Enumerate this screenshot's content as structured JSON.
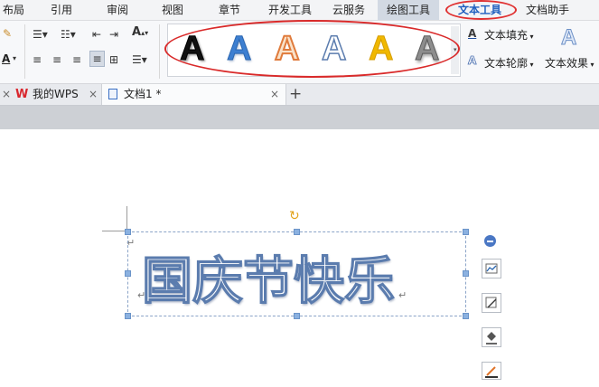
{
  "menu": {
    "tabs": [
      "布局",
      "引用",
      "审阅",
      "视图",
      "章节",
      "开发工具",
      "云服务",
      "绘图工具",
      "文本工具",
      "文档助手"
    ],
    "active": "文本工具"
  },
  "ribbon": {
    "style_glyphs": [
      "A",
      "A",
      "A",
      "A",
      "A",
      "A"
    ],
    "style_colors": [
      "#111111",
      "#3d7fd1",
      "#e07b3c",
      "#ffffff",
      "#f0b800",
      "#6f6f6f"
    ],
    "text_fill_label": "文本填充",
    "text_outline_label": "文本轮廓",
    "text_effect_label": "文本效果",
    "font_size_glyph": "A",
    "text_fill_icon": "A",
    "text_outline_icon": "A"
  },
  "doc_tabs": {
    "home": "我的WPS",
    "doc": "文档1 *",
    "close": "×",
    "add": "+"
  },
  "document": {
    "textbox_text": "国庆节快乐",
    "paragraph_mark": "↵"
  }
}
